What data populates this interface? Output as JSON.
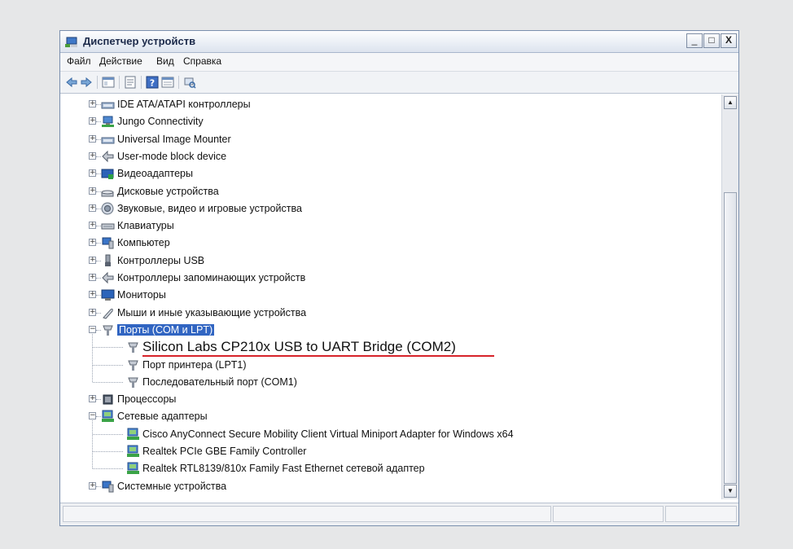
{
  "window": {
    "title": "Диспетчер устройств",
    "minimize": "_",
    "maximize": "□",
    "close": "X"
  },
  "menu": [
    "Файл",
    "Действие",
    "Вид",
    "Справка"
  ],
  "toolbar": {
    "icons": [
      "back-arrow-icon",
      "forward-arrow-icon",
      "console-tree-icon",
      "properties-icon",
      "help-icon",
      "details-icon",
      "scan-hardware-icon"
    ]
  },
  "tree": {
    "items": [
      {
        "label": "IDE ATA/ATAPI контроллеры",
        "icon": "ide-controller-icon",
        "level": 0,
        "expander": "+"
      },
      {
        "label": "Jungo Connectivity",
        "icon": "network-device-icon",
        "level": 0,
        "expander": "+"
      },
      {
        "label": "Universal Image Mounter",
        "icon": "ide-controller-icon",
        "level": 0,
        "expander": "+"
      },
      {
        "label": "User-mode block device",
        "icon": "block-device-icon",
        "level": 0,
        "expander": "+"
      },
      {
        "label": "Видеоадаптеры",
        "icon": "display-adapter-icon",
        "level": 0,
        "expander": "+"
      },
      {
        "label": "Дисковые устройства",
        "icon": "disk-drive-icon",
        "level": 0,
        "expander": "+"
      },
      {
        "label": "Звуковые, видео и игровые устройства",
        "icon": "speaker-icon",
        "level": 0,
        "expander": "+"
      },
      {
        "label": "Клавиатуры",
        "icon": "keyboard-icon",
        "level": 0,
        "expander": "+"
      },
      {
        "label": "Компьютер",
        "icon": "computer-icon",
        "level": 0,
        "expander": "+"
      },
      {
        "label": "Контроллеры USB",
        "icon": "usb-icon",
        "level": 0,
        "expander": "+"
      },
      {
        "label": "Контроллеры запоминающих устройств",
        "icon": "block-device-icon",
        "level": 0,
        "expander": "+"
      },
      {
        "label": "Мониторы",
        "icon": "monitor-icon",
        "level": 0,
        "expander": "+"
      },
      {
        "label": "Мыши и иные указывающие устройства",
        "icon": "mouse-icon",
        "level": 0,
        "expander": "+"
      },
      {
        "label": "Порты (COM и LPT)",
        "icon": "port-icon",
        "level": 0,
        "expander": "−",
        "selected": true
      },
      {
        "label": "Silicon Labs CP210x USB to UART Bridge (COM2)",
        "icon": "port-icon",
        "level": 1,
        "highlighted": true
      },
      {
        "label": "Порт принтера (LPT1)",
        "icon": "port-icon",
        "level": 1
      },
      {
        "label": "Последовательный порт (COM1)",
        "icon": "port-icon",
        "level": 1
      },
      {
        "label": "Процессоры",
        "icon": "processor-icon",
        "level": 0,
        "expander": "+"
      },
      {
        "label": "Сетевые адаптеры",
        "icon": "network-adapter-icon",
        "level": 0,
        "expander": "−"
      },
      {
        "label": "Cisco AnyConnect Secure Mobility Client Virtual Miniport Adapter for Windows x64",
        "icon": "network-adapter-icon",
        "level": 1
      },
      {
        "label": "Realtek PCIe GBE Family Controller",
        "icon": "network-adapter-icon",
        "level": 1
      },
      {
        "label": "Realtek RTL8139/810x Family Fast Ethernet сетевой адаптер",
        "icon": "network-adapter-icon",
        "level": 1
      },
      {
        "label": "Системные устройства",
        "icon": "computer-icon",
        "level": 0,
        "expander": "+"
      }
    ]
  },
  "scrollbar": {
    "up": "▲",
    "down": "▼"
  },
  "colors": {
    "selection": "#3165c2",
    "highlight_underline": "#d7232a",
    "background": "#e6e7e8"
  }
}
